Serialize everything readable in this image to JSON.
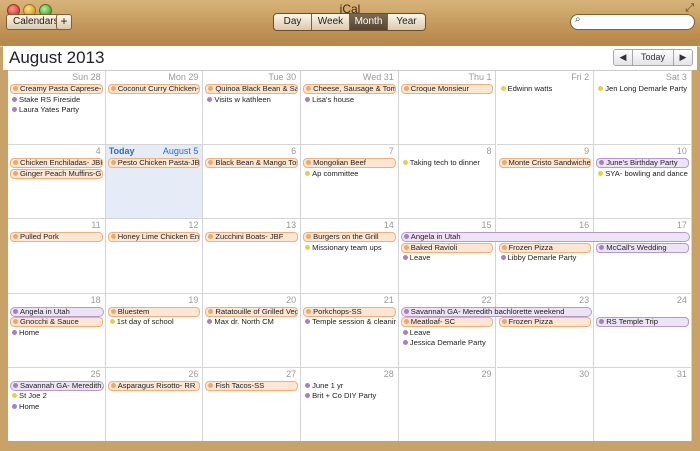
{
  "window": {
    "title": "iCal"
  },
  "toolbar": {
    "calendars_label": "Calendars",
    "add_label": "+",
    "views": [
      "Day",
      "Week",
      "Month",
      "Year"
    ],
    "active_view": "Month",
    "search_placeholder": ""
  },
  "header": {
    "month_title": "August 2013",
    "today_button": "Today",
    "prev": "◀",
    "next": "▶"
  },
  "colors": {
    "orange": "#f0a868",
    "purple": "#a77fc6",
    "yellow": "#e5cf4b",
    "today_blue": "#2a6cd0"
  },
  "today": {
    "label": "Today",
    "date": "August 5"
  },
  "weeks": [
    [
      {
        "num": "Sun 28",
        "muted": true,
        "events": [
          {
            "t": "Creamy Pasta Caprese-...",
            "c": "orange",
            "bar": true
          },
          {
            "t": "Stake RS Fireside",
            "c": "purple"
          },
          {
            "t": "Laura Yates Party",
            "c": "purple"
          }
        ]
      },
      {
        "num": "Mon 29",
        "muted": true,
        "events": [
          {
            "t": "Coconut Curry Chicken-...",
            "c": "orange",
            "bar": true
          }
        ]
      },
      {
        "num": "Tue 30",
        "muted": true,
        "events": [
          {
            "t": "Quinoa Black Bean & Sal...",
            "c": "orange",
            "bar": true
          },
          {
            "t": "Visits w kathleen",
            "c": "purple"
          }
        ]
      },
      {
        "num": "Wed 31",
        "muted": true,
        "events": [
          {
            "t": "Cheese, Sausage & Tom...",
            "c": "orange",
            "bar": true
          },
          {
            "t": "Lisa's house",
            "c": "purple"
          }
        ]
      },
      {
        "num": "Thu 1",
        "events": [
          {
            "t": "Croque Monsieur",
            "c": "orange",
            "bar": true
          }
        ]
      },
      {
        "num": "Fri 2",
        "events": [
          {
            "t": "Edwinn watts",
            "c": "yellow"
          }
        ]
      },
      {
        "num": "Sat 3",
        "events": [
          {
            "t": "Jen Long Demarle Party",
            "c": "yellow"
          }
        ]
      }
    ],
    [
      {
        "num": "4",
        "events": [
          {
            "t": "Chicken Enchiladas- JBF",
            "c": "orange",
            "bar": true
          },
          {
            "t": "Ginger Peach Muffins-G...",
            "c": "orange",
            "bar": true
          }
        ]
      },
      {
        "num": "August 5",
        "today": true,
        "events": [
          {
            "t": "Pesto Chicken Pasta-JBF",
            "c": "orange",
            "bar": true
          }
        ]
      },
      {
        "num": "6",
        "events": [
          {
            "t": "Black Bean & Mango Tos...",
            "c": "orange",
            "bar": true
          }
        ]
      },
      {
        "num": "7",
        "events": [
          {
            "t": "Mongolian Beef",
            "c": "orange",
            "bar": true
          },
          {
            "t": "Ap committee",
            "c": "yellow"
          }
        ]
      },
      {
        "num": "8",
        "events": [
          {
            "t": "Taking tech to dinner",
            "c": "yellow"
          }
        ]
      },
      {
        "num": "9",
        "events": [
          {
            "t": "Monte Cristo Sandwiche...",
            "c": "orange",
            "bar": true
          }
        ]
      },
      {
        "num": "10",
        "events": [
          {
            "t": "June's Birthday Party",
            "c": "purple",
            "bar": true
          },
          {
            "t": "SYA- bowling and dance",
            "c": "yellow"
          }
        ]
      }
    ],
    [
      {
        "num": "11",
        "events": [
          {
            "t": "Pulled Pork",
            "c": "orange",
            "bar": true
          }
        ]
      },
      {
        "num": "12",
        "events": [
          {
            "t": "Honey Lime Chicken Enc...",
            "c": "orange",
            "bar": true
          }
        ]
      },
      {
        "num": "13",
        "events": [
          {
            "t": "Zucchini Boats- JBF",
            "c": "orange",
            "bar": true
          }
        ]
      },
      {
        "num": "14",
        "events": [
          {
            "t": "Burgers on the Grill",
            "c": "orange",
            "bar": true
          },
          {
            "t": "Missionary team ups",
            "c": "yellow"
          }
        ]
      },
      {
        "num": "15",
        "events": [
          {
            "t": "",
            "c": "none",
            "spacer": true
          },
          {
            "t": "Baked Ravioli",
            "c": "orange",
            "bar": true
          },
          {
            "t": "Leave",
            "c": "purple"
          }
        ]
      },
      {
        "num": "16",
        "events": [
          {
            "t": "",
            "c": "none",
            "spacer": true
          },
          {
            "t": "Frozen Pizza",
            "c": "orange",
            "bar": true
          },
          {
            "t": "Libby Demarle Party",
            "c": "purple"
          }
        ]
      },
      {
        "num": "17",
        "events": [
          {
            "t": "",
            "c": "none",
            "spacer": true
          },
          {
            "t": "McCall's Wedding",
            "c": "purple",
            "bar": true
          }
        ]
      }
    ],
    [
      {
        "num": "18",
        "events": [
          {
            "t": "",
            "c": "none",
            "spacer": true
          },
          {
            "t": "Gnocchi & Sauce",
            "c": "orange",
            "bar": true
          },
          {
            "t": "Home",
            "c": "purple"
          }
        ]
      },
      {
        "num": "19",
        "events": [
          {
            "t": "Bluestem",
            "c": "orange",
            "bar": true
          },
          {
            "t": "1st day of school",
            "c": "yellow"
          }
        ]
      },
      {
        "num": "20",
        "events": [
          {
            "t": "Ratatouille of Grilled Veg...",
            "c": "orange",
            "bar": true
          },
          {
            "t": "Max dr. North CM",
            "c": "purple"
          }
        ]
      },
      {
        "num": "21",
        "events": [
          {
            "t": "Porkchops-SS",
            "c": "orange",
            "bar": true
          },
          {
            "t": "Temple session & cleaning",
            "c": "purple"
          }
        ]
      },
      {
        "num": "22",
        "events": [
          {
            "t": "",
            "c": "none",
            "spacer": true
          },
          {
            "t": "Meatloaf- SC",
            "c": "orange",
            "bar": true
          },
          {
            "t": "Leave",
            "c": "purple"
          },
          {
            "t": "Jessica Demarle Party",
            "c": "purple"
          }
        ]
      },
      {
        "num": "23",
        "events": [
          {
            "t": "",
            "c": "none",
            "spacer": true
          },
          {
            "t": "Frozen Pizza",
            "c": "orange",
            "bar": true
          }
        ]
      },
      {
        "num": "24",
        "events": [
          {
            "t": "",
            "c": "none",
            "spacer": true
          },
          {
            "t": "RS Temple Trip",
            "c": "purple",
            "bar": true
          }
        ]
      }
    ],
    [
      {
        "num": "25",
        "events": [
          {
            "t": "",
            "c": "none",
            "spacer": true
          },
          {
            "t": "St Joe 2",
            "c": "yellow"
          },
          {
            "t": "Home",
            "c": "purple"
          }
        ]
      },
      {
        "num": "26",
        "events": [
          {
            "t": "Asparagus Risotto- RR",
            "c": "orange",
            "bar": true
          }
        ]
      },
      {
        "num": "27",
        "events": [
          {
            "t": "Fish Tacos-SS",
            "c": "orange",
            "bar": true
          }
        ]
      },
      {
        "num": "28",
        "events": [
          {
            "t": "June 1 yr",
            "c": "purple"
          },
          {
            "t": "Brit + Co DIY Party",
            "c": "purple"
          }
        ]
      },
      {
        "num": "29",
        "events": []
      },
      {
        "num": "30",
        "events": []
      },
      {
        "num": "31",
        "events": []
      }
    ]
  ],
  "spans": [
    {
      "t": "Angela in Utah",
      "week": 2,
      "start": 4,
      "end": 6
    },
    {
      "t": "Angela in Utah",
      "week": 3,
      "start": 0,
      "end": 0
    },
    {
      "t": "Savannah GA- Meredith bachlorette weekend",
      "week": 3,
      "start": 4,
      "end": 5
    },
    {
      "t": "Savannah GA- Meredith...",
      "week": 4,
      "start": 0,
      "end": 0
    }
  ]
}
